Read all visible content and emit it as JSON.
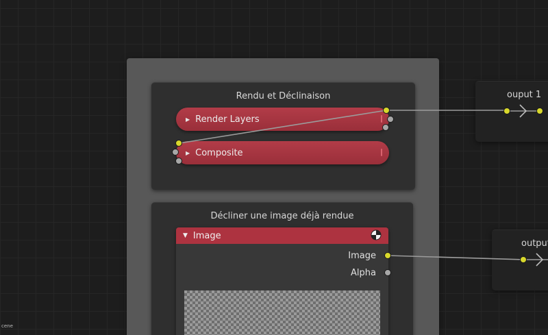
{
  "frame_group_1": {
    "title": "Rendu et Déclinaison",
    "nodes": [
      {
        "label": "Render Layers"
      },
      {
        "label": "Composite"
      }
    ]
  },
  "frame_group_2": {
    "title": "Décliner une image déjà rendue",
    "image_node": {
      "header": "Image",
      "outputs": [
        "Image",
        "Alpha"
      ]
    }
  },
  "right_nodes": [
    {
      "title": "ouput 1"
    },
    {
      "title": "output"
    }
  ],
  "corner_text": "cene",
  "colors": {
    "node_red": "#ad3340",
    "socket_yellow": "#d8d82c",
    "socket_grey": "#a7a7a7",
    "frame": "#585858"
  },
  "icons": {
    "expand": "triangle-right",
    "collapse": "triangle-down",
    "image_node": "half-circle-image-icon",
    "reroute": "chevron-right"
  }
}
